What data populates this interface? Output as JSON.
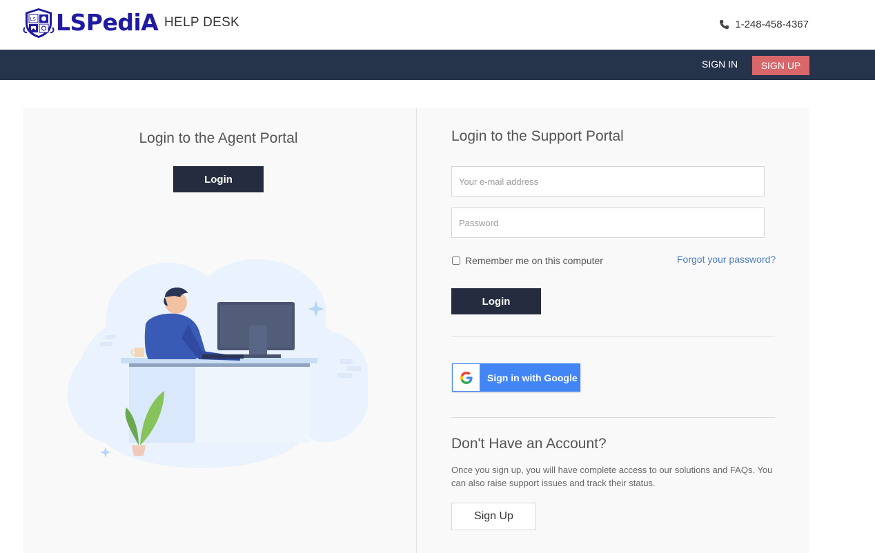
{
  "header": {
    "brand": "LSPediA",
    "helpdesk_label": "HELP DESK",
    "phone": "1-248-458-4367"
  },
  "nav": {
    "signin_label": "SIGN IN",
    "signup_label": "SIGN UP"
  },
  "agent": {
    "title": "Login to the Agent Portal",
    "login_label": "Login"
  },
  "support": {
    "title": "Login to the Support Portal",
    "email_placeholder": "Your e-mail address",
    "password_placeholder": "Password",
    "remember_label": "Remember me on this computer",
    "remember_checked": false,
    "forgot_label": "Forgot your password?",
    "login_label": "Login",
    "google_label": "Sign in with Google"
  },
  "no_account": {
    "title": "Don't Have an Account?",
    "text": "Once you sign up, you will have complete access to our solutions and FAQs. You can also raise support issues and track their status.",
    "signup_label": "Sign Up"
  },
  "colors": {
    "navbar": "#26344b",
    "signup_accent": "#d9676a",
    "brand": "#1f1aa0",
    "button_dark": "#252c3f",
    "google_blue": "#4285f4",
    "link": "#4a7fc1"
  },
  "icons": {
    "phone": "phone-icon",
    "google": "google-icon",
    "logo": "lspedia-shield-icon",
    "illustration": "agent-at-desk-illustration"
  }
}
